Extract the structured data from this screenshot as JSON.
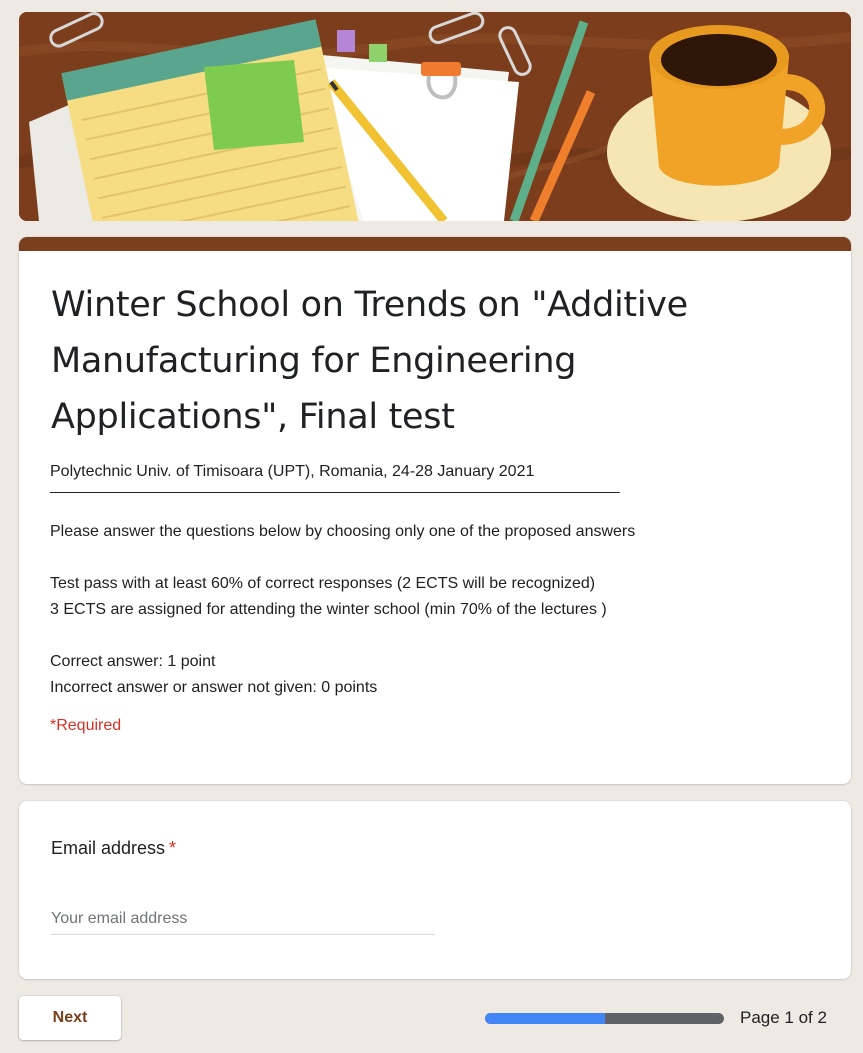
{
  "form": {
    "title": "Winter School on Trends on \"Additive Manufacturing for Engineering Applications\", Final test",
    "description": {
      "subtitle": "Polytechnic Univ. of Timisoara (UPT), Romania, 24-28 January 2021",
      "divider": "________________________________________________________________",
      "instruction": "Please answer the questions below by choosing only one of the proposed answers",
      "pass_rule": "Test pass with at least 60% of correct responses  (2 ECTS will be recognized)",
      "attendance_rule": "3 ECTS are assigned for attending the winter school (min 70% of the lectures )",
      "correct_points": "Correct answer: 1 point",
      "incorrect_points": "Incorrect answer or answer not given:  0 points"
    },
    "required_note": "*Required"
  },
  "email_question": {
    "label": "Email address",
    "required_mark": "*",
    "value": "",
    "placeholder": "Your email address"
  },
  "footer": {
    "next_label": "Next",
    "progress_fraction": 0.5,
    "page_indicator": "Page 1 of 2"
  },
  "colors": {
    "theme": "#7a3f1d",
    "background": "#efe9e4",
    "required": "#d93025",
    "progress_fill": "#4285f4",
    "progress_track": "#5f6368"
  },
  "icons": {
    "banner": "desk-with-notepad-and-coffee-illustration"
  }
}
